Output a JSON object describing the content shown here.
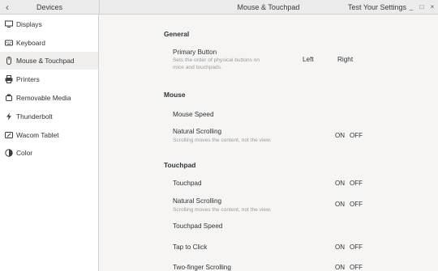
{
  "header": {
    "sidebar_title": "Devices",
    "panel_title": "Mouse & Touchpad",
    "test_button": "Test Your Settings",
    "controls": {
      "minimize": "_",
      "maximize": "□",
      "close": "×"
    },
    "back_glyph": "‹"
  },
  "sidebar": {
    "items": [
      {
        "label": "Displays",
        "icon": "display-icon",
        "selected": false
      },
      {
        "label": "Keyboard",
        "icon": "keyboard-icon",
        "selected": false
      },
      {
        "label": "Mouse & Touchpad",
        "icon": "mouse-icon",
        "selected": true
      },
      {
        "label": "Printers",
        "icon": "printer-icon",
        "selected": false
      },
      {
        "label": "Removable Media",
        "icon": "removable-media-icon",
        "selected": false
      },
      {
        "label": "Thunderbolt",
        "icon": "thunderbolt-icon",
        "selected": false
      },
      {
        "label": "Wacom Tablet",
        "icon": "tablet-icon",
        "selected": false
      },
      {
        "label": "Color",
        "icon": "color-icon",
        "selected": false
      }
    ]
  },
  "general": {
    "title": "General",
    "primary_button": {
      "label": "Primary Button",
      "sub1": "Sets the order of physical buttons on",
      "sub2": "mice and touchpads.",
      "left": "Left",
      "right": "Right"
    }
  },
  "mouse": {
    "title": "Mouse",
    "speed": {
      "label": "Mouse Speed"
    },
    "natural_scrolling": {
      "label": "Natural Scrolling",
      "sub": "Scrolling moves the content, not the view.",
      "on": "ON",
      "off": "OFF"
    }
  },
  "touchpad": {
    "title": "Touchpad",
    "touchpad": {
      "label": "Touchpad",
      "on": "ON",
      "off": "OFF"
    },
    "natural_scrolling": {
      "label": "Natural Scrolling",
      "sub": "Scrolling moves the content, not the view.",
      "on": "ON",
      "off": "OFF"
    },
    "speed": {
      "label": "Touchpad Speed"
    },
    "tap_to_click": {
      "label": "Tap to Click",
      "on": "ON",
      "off": "OFF"
    },
    "two_finger": {
      "label": "Two-finger Scrolling",
      "on": "ON",
      "off": "OFF"
    }
  }
}
